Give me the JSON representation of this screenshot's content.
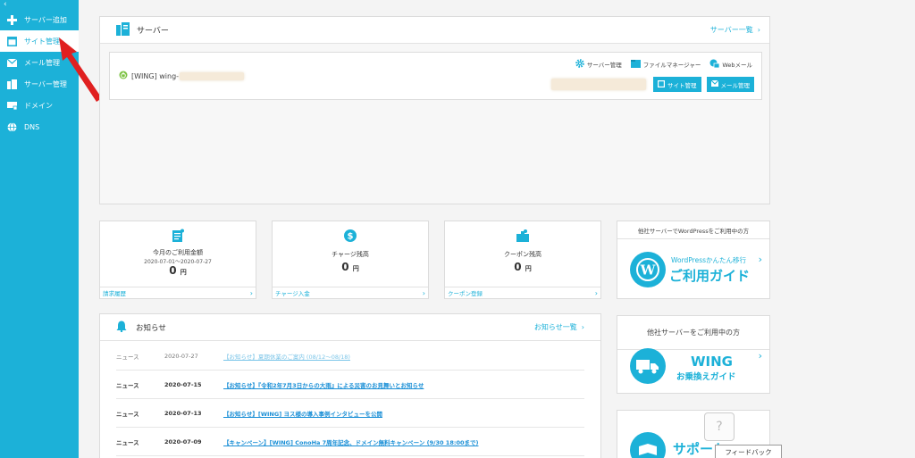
{
  "sidebar": {
    "collapse": "‹",
    "items": [
      {
        "label": "サーバー追加",
        "icon": "plus-icon"
      },
      {
        "label": "サイト管理",
        "icon": "window-icon"
      },
      {
        "label": "メール管理",
        "icon": "mail-icon"
      },
      {
        "label": "サーバー管理",
        "icon": "server-icon"
      },
      {
        "label": "ドメイン",
        "icon": "domain-icon"
      },
      {
        "label": "DNS",
        "icon": "globe-icon"
      }
    ]
  },
  "server_panel": {
    "title": "サーバー",
    "list_link": "サーバー一覧",
    "server_name": "[WING] wing-",
    "tools": {
      "server_manage": "サーバー管理",
      "file_manager": "ファイルマネージャー",
      "webmail": "Webメール"
    },
    "buttons": {
      "site_manage": "サイト管理",
      "mail_manage": "メール管理"
    }
  },
  "stats": [
    {
      "title": "今月のご利用金額",
      "sub": "2020-07-01〜2020-07-27",
      "value": "0",
      "unit": "円",
      "footer": "請求履歴",
      "icon": "invoice-icon"
    },
    {
      "title": "チャージ残高",
      "sub": "",
      "value": "0",
      "unit": "円",
      "footer": "チャージ入金",
      "icon": "dollar-icon"
    },
    {
      "title": "クーポン残高",
      "sub": "",
      "value": "0",
      "unit": "円",
      "footer": "クーポン登録",
      "icon": "coupon-icon"
    }
  ],
  "news": {
    "title": "お知らせ",
    "list_link": "お知らせ一覧",
    "rows": [
      {
        "cat": "ニュース",
        "date": "2020-07-27",
        "title": "【お知らせ】夏期休業のご案内 (08/12〜08/18)"
      },
      {
        "cat": "ニュース",
        "date": "2020-07-15",
        "title": "【お知らせ】『令和2年7月3日からの大雨』による災害のお見舞いとお知らせ"
      },
      {
        "cat": "ニュース",
        "date": "2020-07-13",
        "title": "【お知らせ】[WING] ヨス様の導入事例インタビューを公開"
      },
      {
        "cat": "ニュース",
        "date": "2020-07-09",
        "title": "【キャンペーン】[WING] ConoHa 7周年記念、ドメイン無料キャンペーン (9/30 18:00まで)"
      }
    ]
  },
  "banners": [
    {
      "top": "他社サーバーでWordPressをご利用中の方",
      "line1": "WordPressかんたん移行",
      "line2": "ご利用ガイド"
    },
    {
      "top": "他社サーバーをご利用中の方",
      "line1": "WING",
      "line2": "お乗換えガイド"
    },
    {
      "top": "",
      "line1": "サポート",
      "line2": ""
    }
  ],
  "feedback": "フィードバック",
  "help": "?"
}
